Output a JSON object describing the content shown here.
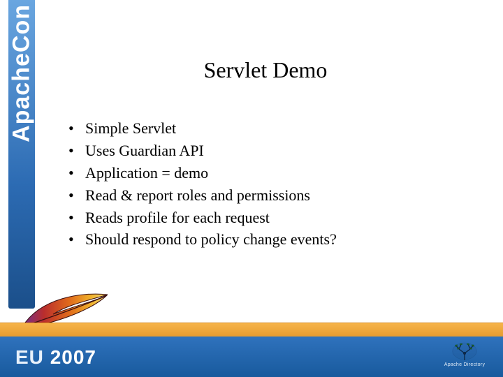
{
  "left_band": {
    "label": "ApacheCon"
  },
  "title": "Servlet Demo",
  "bullets": [
    "Simple Servlet",
    "Uses Guardian API",
    "Application = demo",
    "Read & report roles and permissions",
    "Reads profile for each request",
    "Should respond to policy change events?"
  ],
  "footer": {
    "eu": "EU",
    "year": "2007",
    "logo_label": "Apache Directory"
  }
}
